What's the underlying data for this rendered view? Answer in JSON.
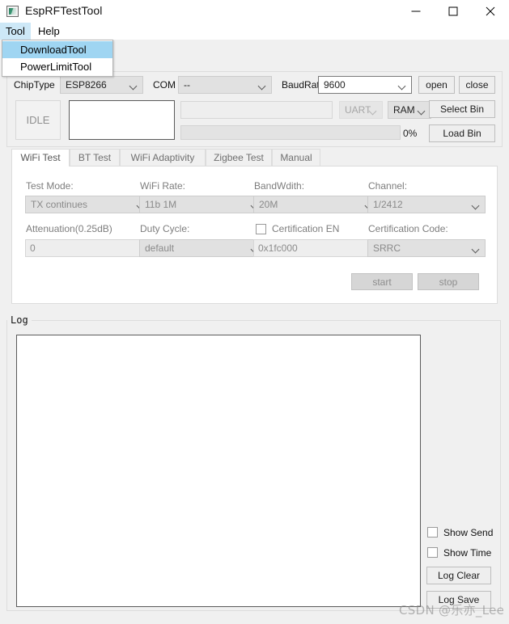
{
  "window": {
    "title": "EspRFTestTool",
    "icon": "app-icon",
    "minimize_label": "—",
    "maximize_label": "□",
    "close_label": "✕"
  },
  "menubar": {
    "items": [
      {
        "label": "Tool",
        "highlighted": true
      },
      {
        "label": "Help",
        "highlighted": false
      }
    ]
  },
  "dropdown": {
    "open_for": "Tool",
    "items": [
      {
        "label": "DownloadTool",
        "selected": true
      },
      {
        "label": "PowerLimitTool",
        "selected": false
      }
    ]
  },
  "connection": {
    "chiptype_label": "ChipType",
    "chiptype_value": "ESP8266",
    "com_label": "COM",
    "com_value": "--",
    "baudrate_label": "BaudRate",
    "baudrate_value": "9600",
    "open_label": "open",
    "close_label": "close",
    "status_value": "IDLE",
    "path_value": "",
    "path_placeholder": "",
    "uart_value": "UART",
    "uart_enabled": false,
    "ram_value": "RAM",
    "select_bin_label": "Select Bin",
    "load_bin_label": "Load Bin",
    "progress_percent": "0%",
    "progress_value": 0
  },
  "tabs": [
    {
      "label": "WiFi Test",
      "active": true
    },
    {
      "label": "BT Test",
      "active": false
    },
    {
      "label": "WiFi Adaptivity",
      "active": false
    },
    {
      "label": "Zigbee Test",
      "active": false
    },
    {
      "label": "Manual",
      "active": false
    }
  ],
  "wifi_test": {
    "test_mode_label": "Test Mode:",
    "test_mode_value": "TX continues",
    "wifi_rate_label": "WiFi Rate:",
    "wifi_rate_value": "11b 1M",
    "bandwidth_label": "BandWdith:",
    "bandwidth_value": "20M",
    "channel_label": "Channel:",
    "channel_value": "1/2412",
    "attenuation_label": "Attenuation(0.25dB)",
    "attenuation_value": "0",
    "duty_cycle_label": "Duty Cycle:",
    "duty_cycle_value": "default",
    "certification_en_label": "Certification EN",
    "certification_en_checked": false,
    "certification_addr_value": "0x1fc000",
    "certification_code_label": "Certification Code:",
    "certification_code_value": "SRRC",
    "start_label": "start",
    "stop_label": "stop"
  },
  "log": {
    "group_title": "Log",
    "content": "",
    "show_send_label": "Show Send",
    "show_send_checked": false,
    "show_time_label": "Show Time",
    "show_time_checked": false,
    "log_clear_label": "Log Clear",
    "log_save_label": "Log Save"
  },
  "watermark": {
    "text": "CSDN @乐亦_Lee"
  },
  "colors": {
    "menu_highlight": "#cde8f7",
    "dropdown_selected": "#9fd5f2",
    "window_bg": "#f0f0f0",
    "panel_bg": "#ffffff",
    "control_bg": "#e1e1e1"
  }
}
